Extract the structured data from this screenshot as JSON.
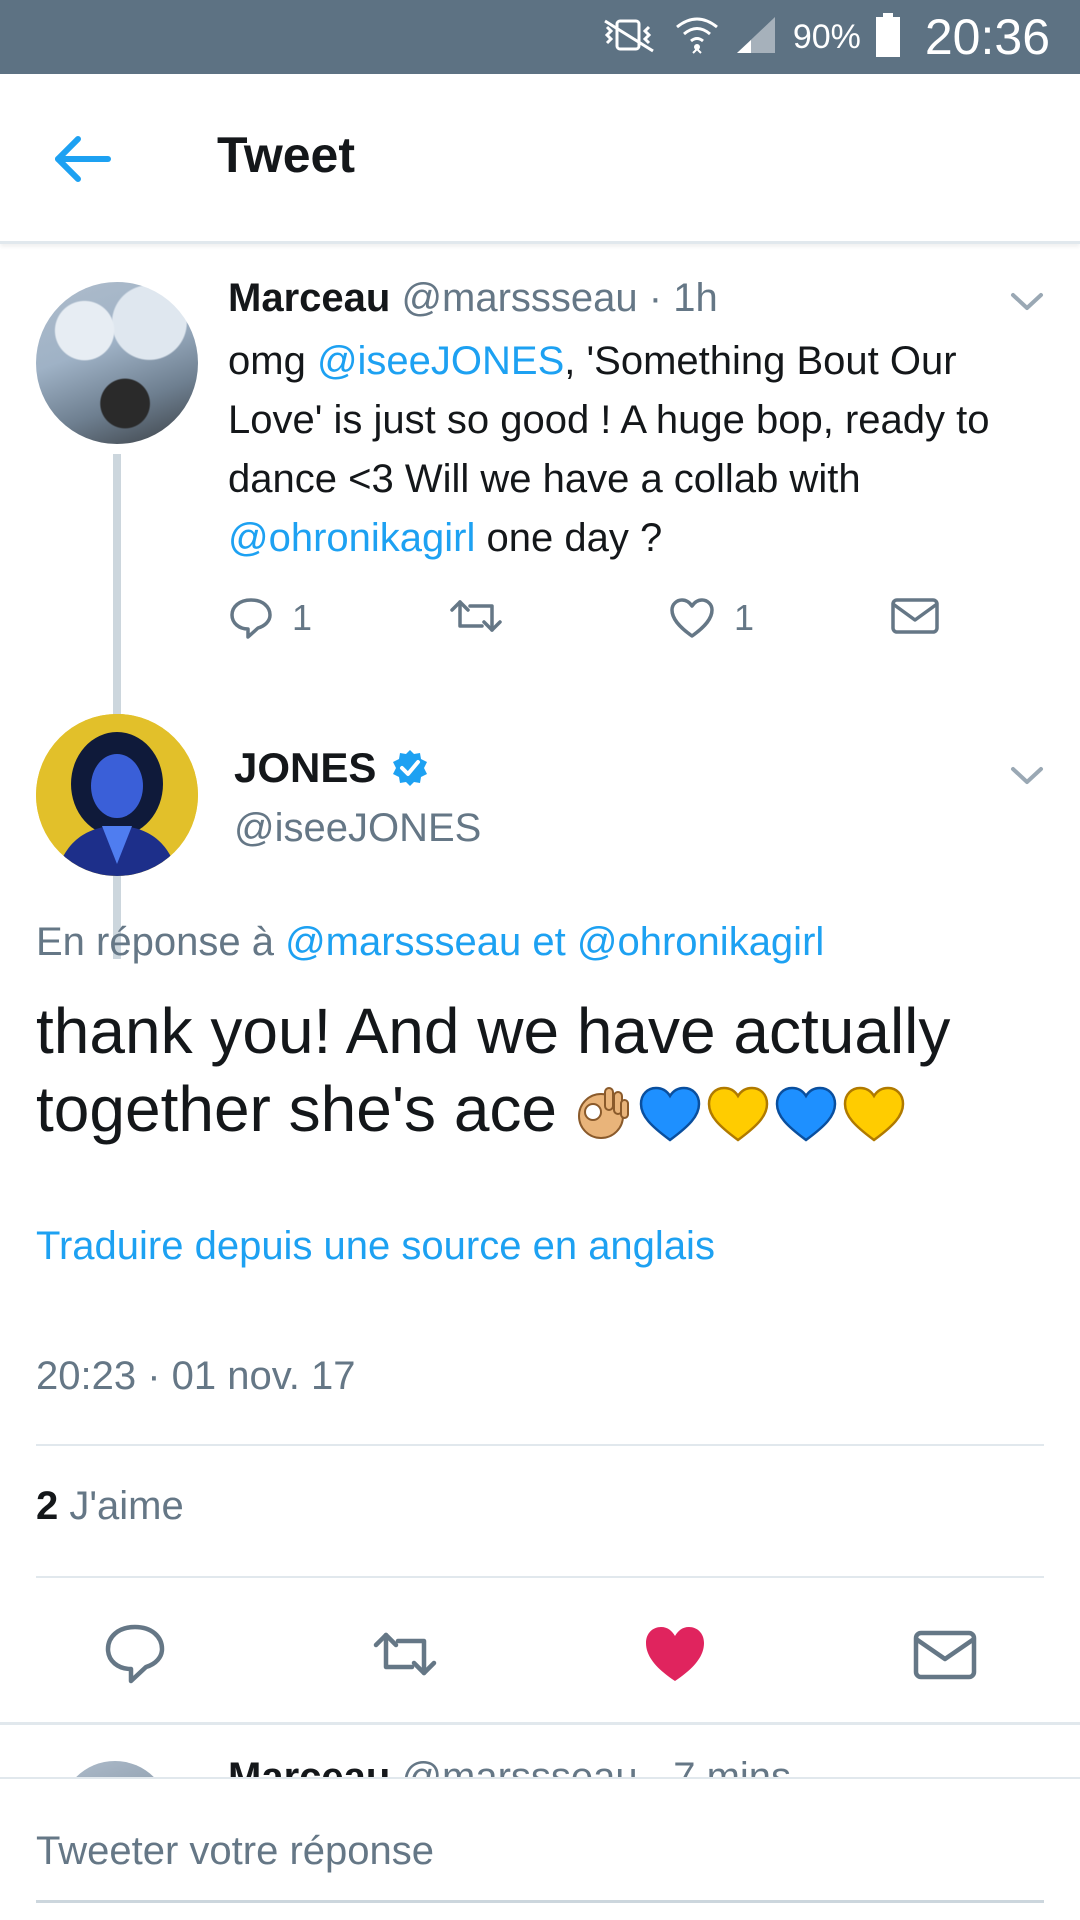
{
  "status_bar": {
    "battery_percent": "90%",
    "time": "20:36"
  },
  "header": {
    "title": "Tweet"
  },
  "parent_tweet": {
    "name": "Marceau",
    "handle": "@marssseau",
    "time_sep": " · ",
    "time": "1h",
    "text": {
      "t1": "omg ",
      "mention1": "@iseeJONES",
      "t2": ", 'Something Bout Our Love' is just so good ! A huge bop, ready to dance <3 Will we have a collab with ",
      "mention2": "@ohronikagirl",
      "t3": " one day ?"
    },
    "reply_count": "1",
    "like_count": "1"
  },
  "main_tweet": {
    "name": "JONES",
    "handle": "@iseeJONES",
    "reply_prefix": "En réponse à ",
    "reply_mention1": "@marssseau",
    "reply_and": " et ",
    "reply_mention2": "@ohronikagirl",
    "text": "thank you! And we have actually together she's ace",
    "translate": "Traduire depuis une source en anglais",
    "timestamp": "20:23 · 01 nov. 17",
    "likes_count": "2",
    "likes_label": " J'aime"
  },
  "next_tweet": {
    "name": "Marceau",
    "handle": "@marssseau",
    "time": " · 7 mins"
  },
  "reply_bar": {
    "placeholder": "Tweeter votre réponse"
  },
  "colors": {
    "accent": "#1da1f2",
    "muted": "#657786",
    "like_active": "#e0245e",
    "status_bar": "#5d7283"
  },
  "icons": {
    "back": "arrow-left-icon",
    "reply": "speech-bubble-icon",
    "retweet": "retweet-icon",
    "like": "heart-icon",
    "dm": "envelope-icon",
    "verified": "verified-badge-icon"
  }
}
